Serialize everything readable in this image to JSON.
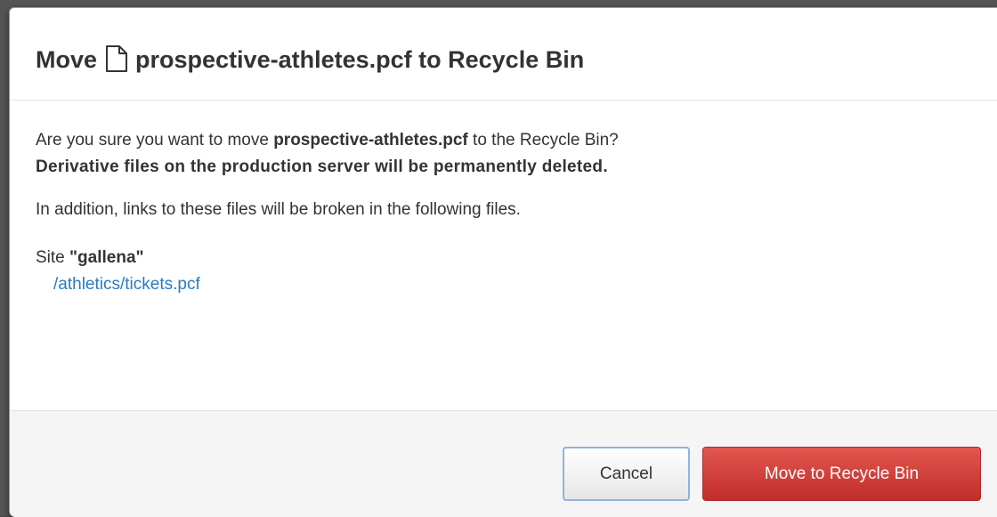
{
  "dialog": {
    "title_prefix": "Move",
    "title_icon": "file-icon",
    "title_filename": "prospective-athletes.pcf",
    "title_suffix": "to Recycle Bin"
  },
  "body": {
    "confirm_prefix": "Are you sure you want to move ",
    "confirm_filename": "prospective-athletes.pcf",
    "confirm_suffix": " to the Recycle Bin?",
    "warning": "Derivative files on the production server will be permanently deleted.",
    "addition": "In addition, links to these files will be broken in the following files.",
    "site_label": "Site ",
    "site_name": "\"gallena\"",
    "affected_file": "/athletics/tickets.pcf"
  },
  "footer": {
    "cancel_label": "Cancel",
    "confirm_label": "Move to Recycle Bin"
  },
  "colors": {
    "link": "#2a7ac0",
    "danger": "#d9534f",
    "text": "#333333",
    "footer_bg": "#f5f5f5"
  }
}
